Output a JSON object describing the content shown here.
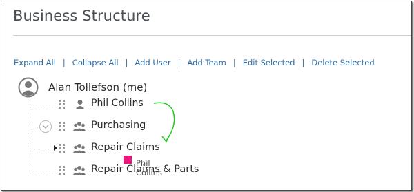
{
  "header": {
    "title": "Business Structure"
  },
  "toolbar": {
    "expand_all": "Expand All",
    "collapse_all": "Collapse All",
    "add_user": "Add User",
    "add_team": "Add Team",
    "edit_selected": "Edit Selected",
    "delete_selected": "Delete Selected",
    "separator": "|"
  },
  "tree": {
    "root": {
      "label": "Alan Tollefson (me)",
      "icon": "user-avatar-icon"
    },
    "children": [
      {
        "label": "Phil Collins",
        "icon": "user-icon"
      },
      {
        "label": "Purchasing",
        "icon": "team-icon",
        "expand_icon": "chevron-down-icon"
      },
      {
        "label": "Repair Claims",
        "icon": "team-icon",
        "indicator": "caret-right-icon"
      },
      {
        "label": "Repair Claims & Parts",
        "icon": "team-icon"
      }
    ]
  },
  "drag": {
    "ghost_label": "Phil Collins",
    "ghost_color": "#e8157a",
    "arrow_color": "#22cc22"
  },
  "colors": {
    "link": "#2f6ea8",
    "text": "#2d2d2d",
    "title": "#4a4f56"
  }
}
